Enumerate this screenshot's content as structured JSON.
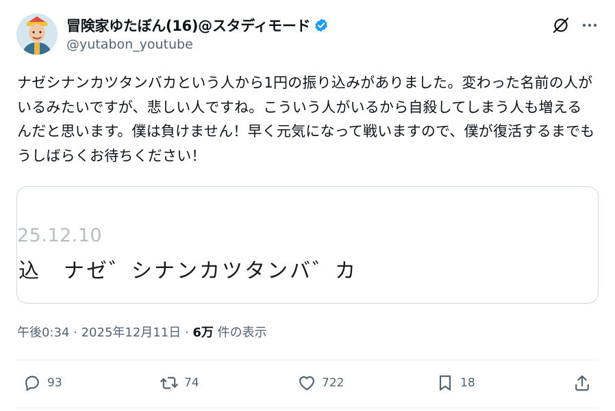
{
  "author": {
    "name": "冒険家ゆたぼん(16)@スタディモード",
    "handle": "@yutabon_youtube"
  },
  "tweet": {
    "text": "ナゼシナンカツタンバカという人から1円の振り込みがありました。変わった名前の人がいるみたいですが、悲しい人ですね。こういう人がいるから自殺してしまう人も増えるんだと思います。僕は負けません！早く元気になって戦いますので、僕が復活するまでもうしばらくお待ちください！"
  },
  "media": {
    "date": "25.12.10",
    "line": "込　ナゼ゛シナンカツタンバ゛カ"
  },
  "meta": {
    "time": "午後0:34",
    "sep1": " · ",
    "date": "2025年12月11日",
    "sep2": " · ",
    "views": "6万",
    "views_label": " 件の表示"
  },
  "actions": {
    "replies": "93",
    "reposts": "74",
    "likes": "722",
    "bookmarks": "18"
  },
  "colors": {
    "verified": "#1d9bf0",
    "icon": "#536471"
  }
}
